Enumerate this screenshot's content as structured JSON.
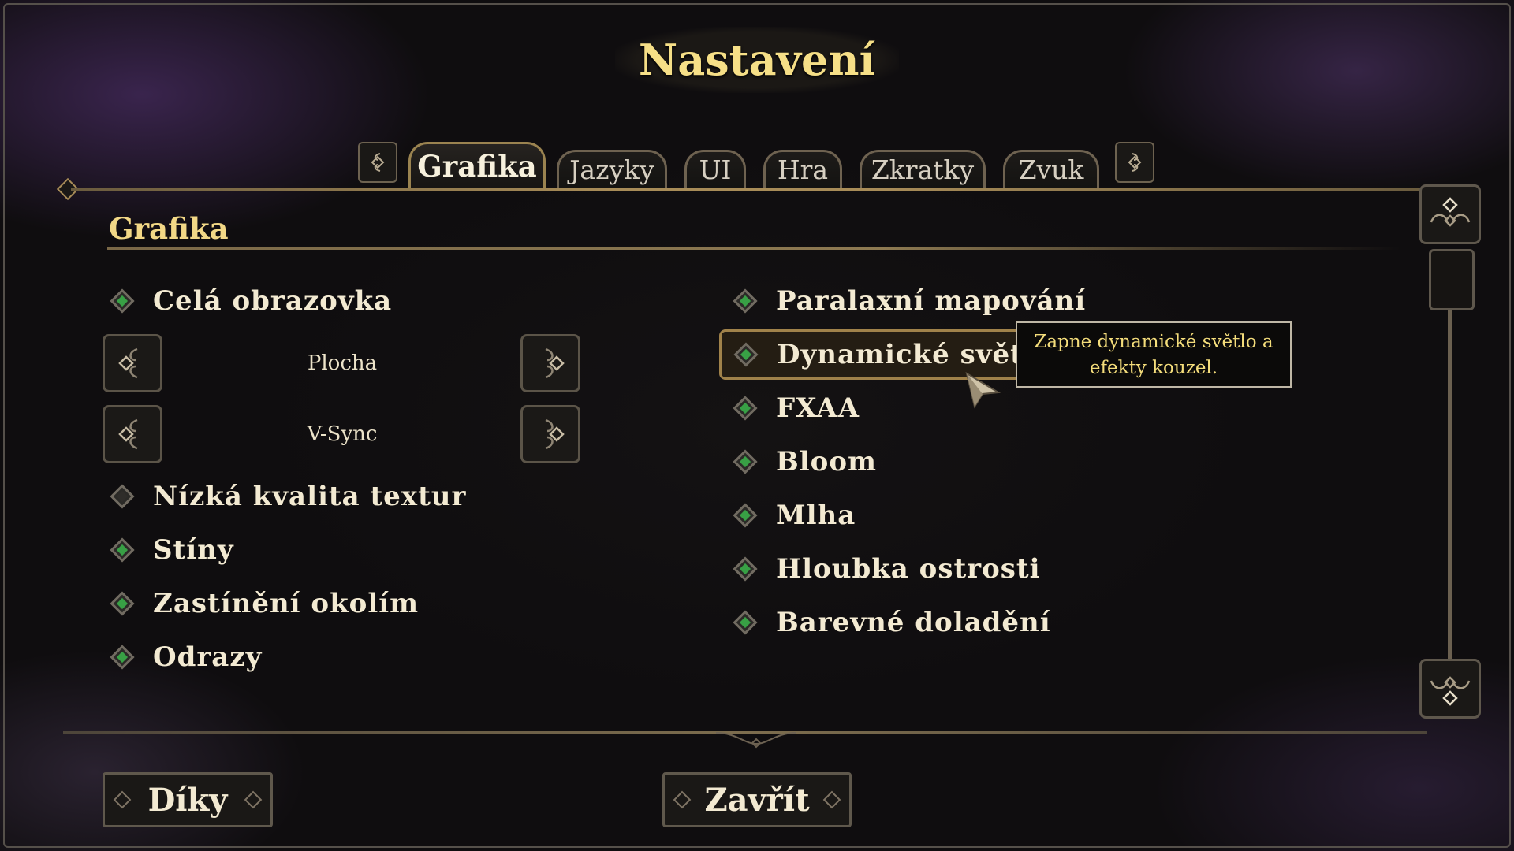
{
  "title": "Nastavení",
  "tabs": [
    {
      "label": "Grafika",
      "active": true
    },
    {
      "label": "Jazyky",
      "active": false
    },
    {
      "label": "UI",
      "active": false
    },
    {
      "label": "Hra",
      "active": false
    },
    {
      "label": "Zkratky",
      "active": false
    },
    {
      "label": "Zvuk",
      "active": false
    }
  ],
  "section": {
    "title": "Grafika"
  },
  "left_options": {
    "fullscreen": {
      "label": "Celá obrazovka",
      "enabled": true
    },
    "display_mode": {
      "value": "Plocha"
    },
    "vsync": {
      "value": "V-Sync"
    },
    "low_textures": {
      "label": "Nízká kvalita textur",
      "enabled": false
    },
    "shadows": {
      "label": "Stíny",
      "enabled": true
    },
    "ambient_occlusion": {
      "label": "Zastínění okolím",
      "enabled": true
    },
    "reflections": {
      "label": "Odrazy",
      "enabled": true
    }
  },
  "right_options": {
    "parallax": {
      "label": "Paralaxní mapování",
      "enabled": true
    },
    "dynamic_light": {
      "label": "Dynamické světlo",
      "enabled": true
    },
    "fxaa": {
      "label": "FXAA",
      "enabled": true
    },
    "bloom": {
      "label": "Bloom",
      "enabled": true
    },
    "fog": {
      "label": "Mlha",
      "enabled": true
    },
    "dof": {
      "label": "Hloubka ostrosti",
      "enabled": true
    },
    "color_grading": {
      "label": "Barevné doladění",
      "enabled": true
    }
  },
  "tooltip": {
    "line1": "Zapne dynamické světlo a",
    "line2": "efekty kouzel."
  },
  "buttons": {
    "thanks": "Díky",
    "close": "Zavřít"
  },
  "colors": {
    "accent": "#f6df87",
    "checked": "#38a045",
    "border": "#a88c58"
  }
}
